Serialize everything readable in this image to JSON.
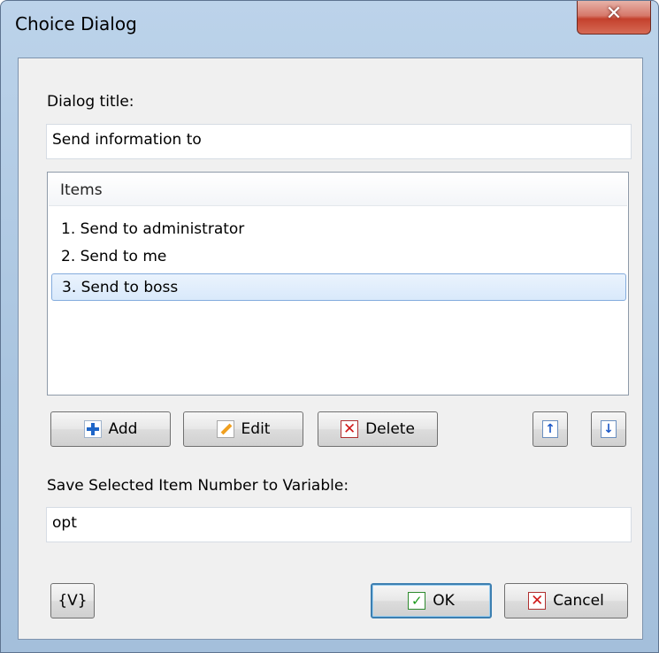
{
  "window": {
    "title": "Choice Dialog",
    "close_glyph": "✕"
  },
  "dialog_title": {
    "label": "Dialog title:",
    "value": "Send information to"
  },
  "list": {
    "header": "Items",
    "items": [
      {
        "label": "1. Send to administrator",
        "selected": false
      },
      {
        "label": "2. Send to me",
        "selected": false
      },
      {
        "label": "3. Send to boss",
        "selected": true
      }
    ]
  },
  "buttons": {
    "add": "Add",
    "edit": "Edit",
    "delete": "Delete",
    "move_up_icon": "arrow-up-icon",
    "move_down_icon": "arrow-down-icon",
    "variable": "{V}",
    "ok": "OK",
    "cancel": "Cancel"
  },
  "variable": {
    "label": "Save Selected Item Number to Variable:",
    "value": "opt"
  },
  "colors": {
    "selection": "#d9e9fb",
    "selection_border": "#84acdd",
    "close_button": "#c4412d",
    "frame": "#a9c4df"
  }
}
